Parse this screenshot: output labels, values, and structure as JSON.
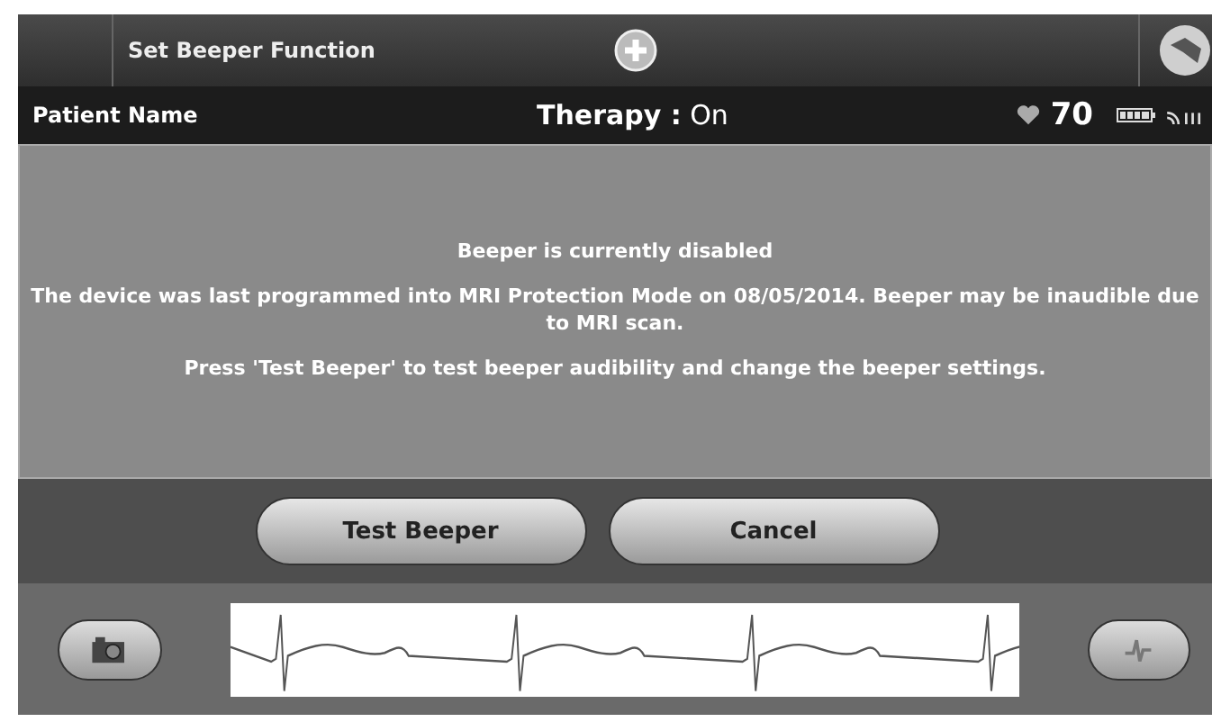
{
  "header": {
    "title": "Set Beeper Function"
  },
  "status_bar": {
    "patient": "Patient Name",
    "therapy": "**Therapy :** On",
    "heart_rate": "70"
  },
  "message": {
    "lines": [
      "Beeper is currently disabled",
      "The device was last programmed into MRI Protection Mode on 08/05/2014. Beeper may be inaudible due to MRI scan.",
      "Press 'Test Beeper' to test beeper audibility and change the beeper settings."
    ]
  },
  "buttons": [
    "Test Beeper",
    "Cancel"
  ]
}
